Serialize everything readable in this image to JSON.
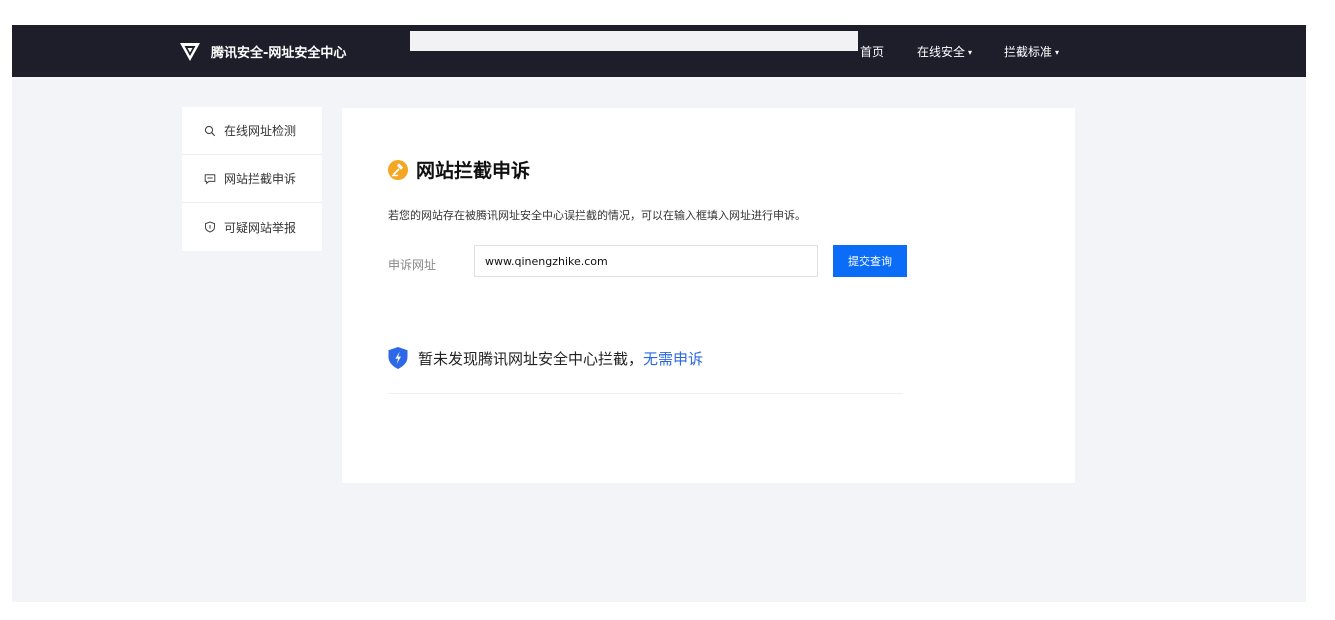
{
  "header": {
    "brand": "腾讯安全-网址安全中心",
    "nav": [
      {
        "label": "首页",
        "has_dropdown": false
      },
      {
        "label": "在线安全",
        "has_dropdown": true
      },
      {
        "label": "拦截标准",
        "has_dropdown": true
      }
    ],
    "caret": "▾"
  },
  "sidebar": {
    "items": [
      {
        "label": "在线网址检测",
        "icon": "search-icon"
      },
      {
        "label": "网站拦截申诉",
        "icon": "chat-icon"
      },
      {
        "label": "可疑网站举报",
        "icon": "shield-icon"
      }
    ]
  },
  "main": {
    "title": "网站拦截申诉",
    "title_icon": "gavel-icon",
    "description": "若您的网站存在被腾讯网址安全中心误拦截的情况，可以在输入框填入网址进行申诉。",
    "form": {
      "label": "申诉网址",
      "value": "www.qinengzhike.com",
      "submit_label": "提交查询"
    },
    "result": {
      "text": "暂未发现腾讯网址安全中心拦截，",
      "link": "无需申诉"
    }
  },
  "colors": {
    "header_bg": "#1d1e2a",
    "page_bg": "#f3f4f7",
    "accent": "#0b6cf7",
    "link": "#2c68e0",
    "title_icon": "#f5a623"
  }
}
